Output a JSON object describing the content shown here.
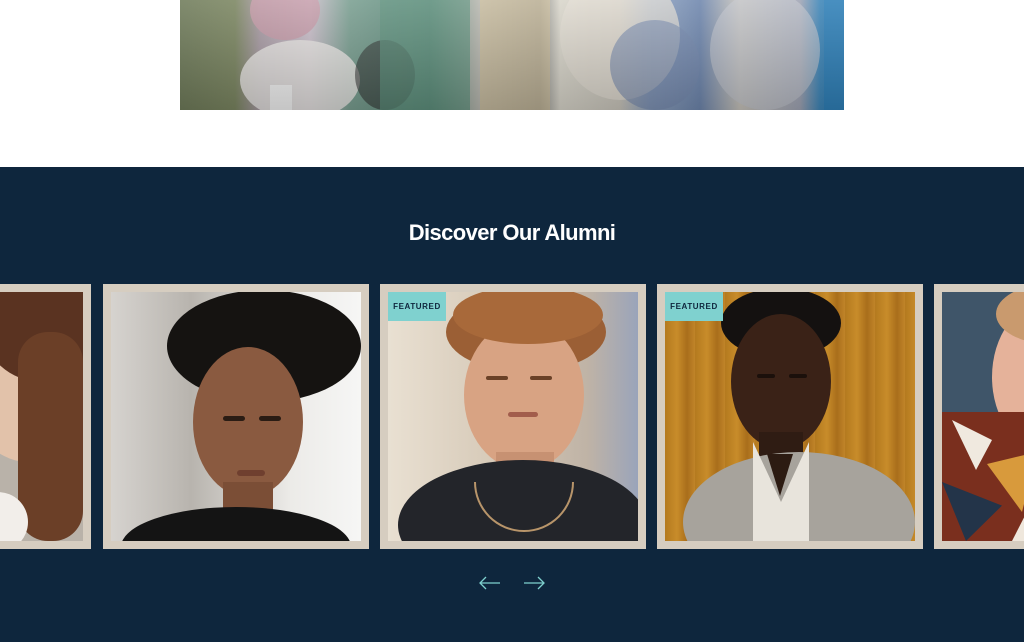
{
  "alumni": {
    "title": "Discover Our Alumni",
    "featured_label": "FEATURED",
    "cards": [
      {
        "description": "Woman with long curly brown hair (partially visible)",
        "featured": false
      },
      {
        "description": "Young woman with natural curly hair, black top",
        "featured": false
      },
      {
        "description": "Young man with wavy reddish-blond hair, black t-shirt, necklace",
        "featured": true
      },
      {
        "description": "Man with short curly hair, grey knit shirt, mustard curtain backdrop",
        "featured": true
      },
      {
        "description": "Man with red patterned shirt (partially visible)",
        "featured": false
      }
    ],
    "prev_icon": "arrow-left-icon",
    "next_icon": "arrow-right-icon"
  },
  "colors": {
    "section_background": "#0e263d",
    "card_border": "#d6cdc0",
    "badge_background": "#7fd1cf",
    "arrow": "#7fd1cf",
    "title": "#ffffff"
  }
}
